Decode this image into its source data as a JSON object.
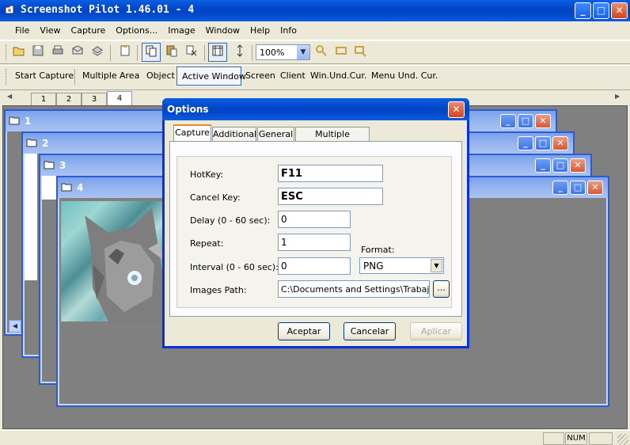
{
  "app": {
    "title": "Screenshot Pilot 1.46.01 - 4"
  },
  "menu": [
    "File",
    "View",
    "Capture",
    "Options...",
    "Image",
    "Window",
    "Help",
    "Info"
  ],
  "toolbar": {
    "zoom": "100%",
    "icons": [
      "open-icon",
      "save-icon",
      "print-icon",
      "mail-icon",
      "save-all-icon",
      "paste-new-icon",
      "copy-icon",
      "paste-icon",
      "delete-icon",
      "fit-window-icon",
      "fit-height-icon",
      "zoom-icon",
      "fit-icon",
      "crop-icon"
    ]
  },
  "capture_bar": {
    "start": "Start Capture",
    "items": [
      "Multiple",
      "Area",
      "Object",
      "Active Window",
      "Screen",
      "Client",
      "Win.Und.Cur.",
      "Menu Und. Cur."
    ],
    "active": "Active Window"
  },
  "tabs": [
    "1",
    "2",
    "3",
    "4"
  ],
  "children": [
    {
      "title": "1"
    },
    {
      "title": "2"
    },
    {
      "title": "3"
    },
    {
      "title": "4"
    }
  ],
  "dialog": {
    "title": "Options",
    "tabs": [
      "Capture",
      "Additional",
      "General",
      "Multiple Captures"
    ],
    "fields": {
      "hotkey_label": "HotKey:",
      "hotkey_value": "F11",
      "cancel_label": "Cancel Key:",
      "cancel_value": "ESC",
      "delay_label": "Delay (0 - 60 sec):",
      "delay_value": "0",
      "repeat_label": "Repeat:",
      "repeat_value": "1",
      "interval_label": "Interval (0 - 60 sec):",
      "interval_value": "0",
      "format_label": "Format:",
      "format_value": "PNG",
      "path_label": "Images Path:",
      "path_value": "C:\\Documents and Settings\\Trabajo\\M",
      "browse": "..."
    },
    "buttons": {
      "ok": "Aceptar",
      "cancel": "Cancelar",
      "apply": "Aplicar"
    }
  },
  "status": {
    "num": "NUM"
  },
  "colors": {
    "xp_blue": "#0a5ae0",
    "mdi_bg": "#808080",
    "dialog_bg": "#ece9d8"
  }
}
